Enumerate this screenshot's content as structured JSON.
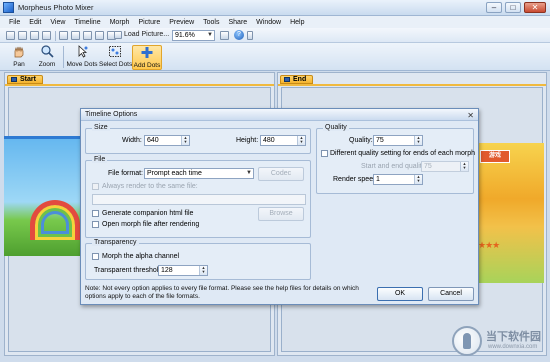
{
  "window": {
    "title": "Morpheus Photo Mixer",
    "min": "–",
    "max": "□",
    "close": "✕"
  },
  "menu": [
    "File",
    "Edit",
    "View",
    "Timeline",
    "Morph",
    "Picture",
    "Preview",
    "Tools",
    "Share",
    "Window",
    "Help"
  ],
  "quick_toolbar": {
    "load_picture_label": "Load Picture...",
    "zoom_value": "91.6%"
  },
  "toolbar": {
    "items": [
      {
        "label": "Pan",
        "icon": "hand-icon"
      },
      {
        "label": "Zoom",
        "icon": "magnifier-icon"
      },
      {
        "label": "Move Dots",
        "icon": "move-dots-icon"
      },
      {
        "label": "Select Dots",
        "icon": "select-dots-icon"
      },
      {
        "label": "Add Dots",
        "icon": "add-dots-icon"
      }
    ],
    "active": "Add Dots"
  },
  "panes": {
    "left_tab": "Start",
    "right_tab": "End"
  },
  "dialog": {
    "title": "Timeline Options",
    "close": "✕",
    "size": {
      "legend": "Size",
      "width_label": "Width:",
      "width_value": "640",
      "height_label": "Height:",
      "height_value": "480"
    },
    "file": {
      "legend": "File",
      "format_label": "File format:",
      "format_value": "Prompt each time",
      "codec_button": "Codec",
      "always_render_label": "Always render to the same file:",
      "browse_button": "Browse",
      "companion_label": "Generate companion html file",
      "open_after_label": "Open morph file after rendering"
    },
    "transparency": {
      "legend": "Transparency",
      "morph_alpha_label": "Morph the alpha channel",
      "threshold_label": "Transparent threshold:",
      "threshold_value": "128"
    },
    "quality": {
      "legend": "Quality",
      "quality_label": "Quality:",
      "quality_value": "75",
      "different_label": "Different quality setting for ends of each morph",
      "start_end_label": "Start and end quality:",
      "start_end_value": "75",
      "render_speed_label": "Render speed:",
      "render_speed_value": "1"
    },
    "note": "Note: Not every option applies to every file format. Please see the help files for details on which options apply to each of the file formats.",
    "ok_button": "OK",
    "cancel_button": "Cancel"
  },
  "background_art": {
    "banner_text": "游戏",
    "stars": "★★★"
  },
  "watermark": {
    "text": "当下软件园",
    "url": "www.downxia.com"
  }
}
